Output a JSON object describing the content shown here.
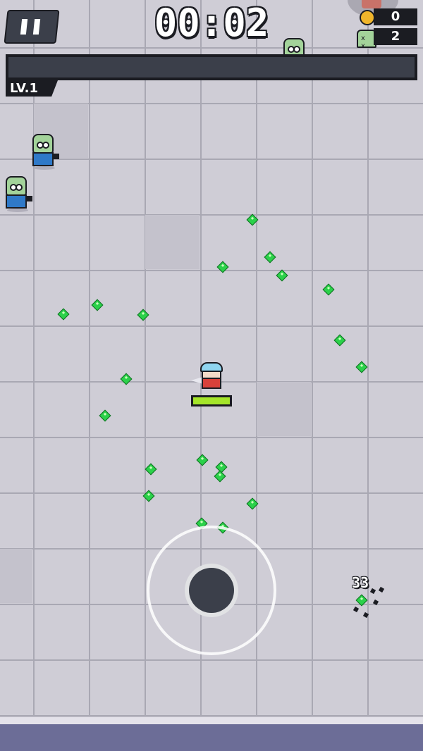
{
  "hud": {
    "timer": "00:02",
    "coins": "0",
    "kills": "2",
    "level_label": "LV.1",
    "xp_progress": 0.0
  },
  "player": {
    "health_fraction": 1.0
  },
  "damage_popup": "33",
  "colors": {
    "floor": "#cfcdd6",
    "grid_line": "#a9a8b3",
    "gem": "#2bd14a",
    "health_bar": "#a5e52a",
    "xp_bar_bg": "#3b3f4a",
    "zombie_skin": "#a3d39a",
    "zombie_shirt": "#2f79c8",
    "player_scarf": "#d7413a",
    "bottom_band": "#6c6d97"
  },
  "icons": {
    "pause": "pause-icon",
    "coin": "coin-icon",
    "kills": "zombie-head-icon"
  }
}
